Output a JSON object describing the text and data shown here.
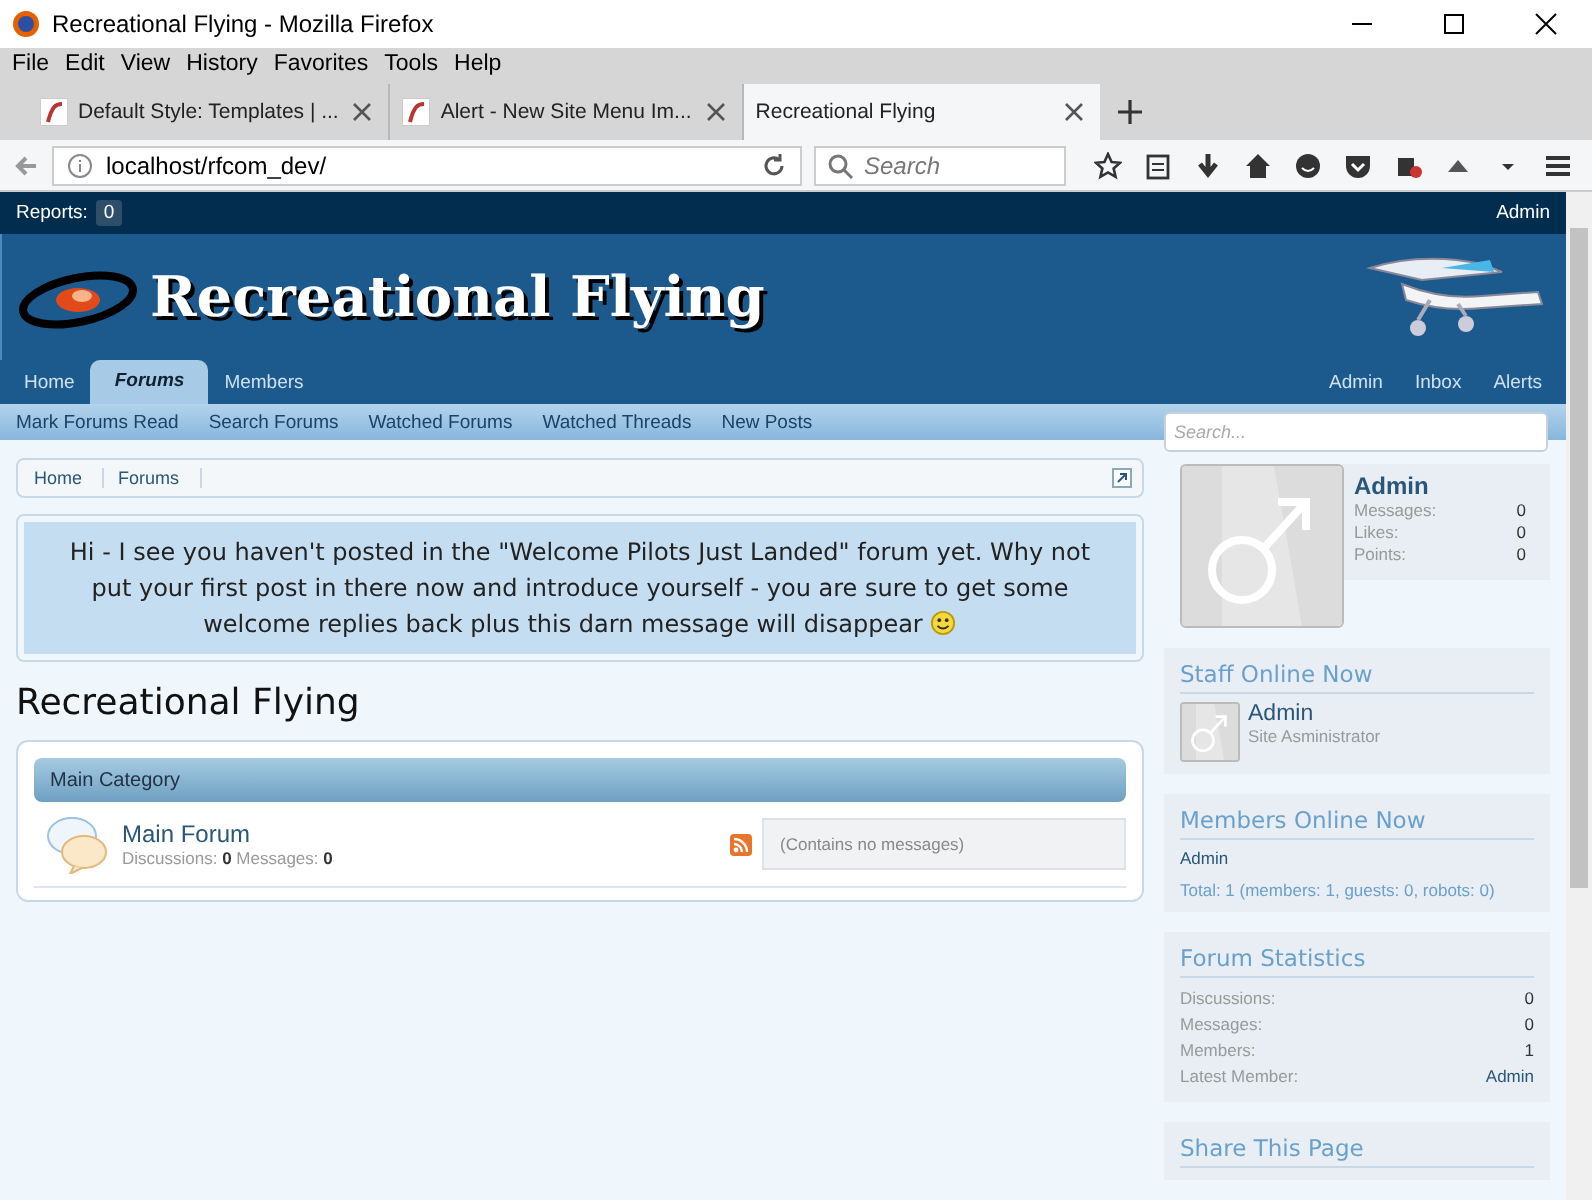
{
  "window": {
    "title": "Recreational Flying - Mozilla Firefox"
  },
  "menu": [
    "File",
    "Edit",
    "View",
    "History",
    "Favorites",
    "Tools",
    "Help"
  ],
  "tabs": [
    {
      "label": "Default Style: Templates | ...",
      "selected": false
    },
    {
      "label": "Alert - New Site Menu Im...",
      "selected": false
    },
    {
      "label": "Recreational Flying",
      "selected": true
    }
  ],
  "address_bar": {
    "url": "localhost/rfcom_dev/",
    "search_placeholder": "Search"
  },
  "forum": {
    "reports": {
      "label": "Reports:",
      "count": "0"
    },
    "account": "Admin",
    "logo": "Recreational Flying",
    "nav_tabs": [
      {
        "label": "Home",
        "selected": false
      },
      {
        "label": "Forums",
        "selected": true
      },
      {
        "label": "Members",
        "selected": false
      }
    ],
    "nav_right": [
      "Admin",
      "Inbox",
      "Alerts"
    ],
    "sub_links": [
      "Mark Forums Read",
      "Search Forums",
      "Watched Forums",
      "Watched Threads",
      "New Posts"
    ],
    "breadcrumbs": [
      "Home",
      "Forums"
    ],
    "notice": "Hi - I see you haven't posted in the \"Welcome Pilots Just Landed\" forum yet. Why not put your first post in there now and introduce yourself - you are sure to get some welcome replies back plus this darn message will disappear",
    "page_title": "Recreational Flying",
    "category": {
      "title": "Main Category",
      "forums": [
        {
          "name": "Main Forum",
          "stats": "Discussions: **0** Messages: **0**",
          "last_post": "(Contains no messages)"
        }
      ]
    },
    "sidebar": {
      "search_placeholder": "Search...",
      "profile": {
        "name": "Admin",
        "stats": [
          {
            "label": "Messages:",
            "value": "0"
          },
          {
            "label": "Likes:",
            "value": "0"
          },
          {
            "label": "Points:",
            "value": "0"
          }
        ]
      },
      "staff_online": {
        "title": "Staff Online Now",
        "members": [
          {
            "name": "Admin",
            "role": "Site Asministrator"
          }
        ]
      },
      "members_online": {
        "title": "Members Online Now",
        "names": [
          "Admin"
        ],
        "total": "Total: 1 (members: 1, guests: 0, robots: 0)"
      },
      "statistics": {
        "title": "Forum Statistics",
        "rows": [
          {
            "label": "Discussions:",
            "value": "0",
            "kind": "number"
          },
          {
            "label": "Messages:",
            "value": "0",
            "kind": "number"
          },
          {
            "label": "Members:",
            "value": "1",
            "kind": "number"
          },
          {
            "label": "Latest Member:",
            "value": "Admin",
            "kind": "link"
          }
        ]
      },
      "share": {
        "title": "Share This Page"
      }
    }
  }
}
